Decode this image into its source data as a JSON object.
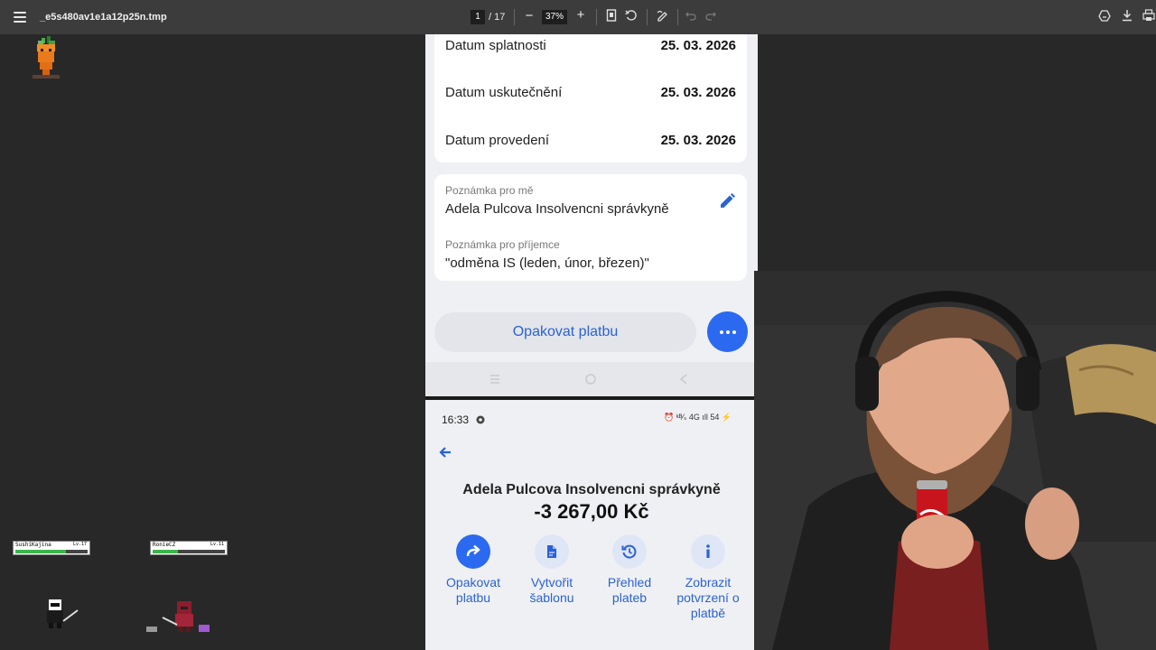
{
  "viewer": {
    "file_name": "_e5s480av1e1a12p25n.tmp",
    "page_current": "1",
    "page_total": "/ 17",
    "zoom": "37%",
    "zoom_out": "−",
    "zoom_in": "+"
  },
  "overlay": {
    "players": [
      {
        "name": "SushiKajina",
        "level": "Lv.17",
        "hp_fraction": 0.7
      },
      {
        "name": "RonieCZ",
        "level": "Lv.11",
        "hp_fraction": 0.35
      }
    ]
  },
  "payment_details": {
    "rows": [
      {
        "label": "Datum splatnosti",
        "value": "25. 03. 2026"
      },
      {
        "label": "Datum uskutečnění",
        "value": "25. 03. 2026"
      },
      {
        "label": "Datum provedení",
        "value": "25. 03. 2026"
      }
    ],
    "note_for_me_label": "Poznámka pro mě",
    "note_for_me": "Adela Pulcova Insolvencni správkyně",
    "note_for_recipient_label": "Poznámka pro příjemce",
    "note_for_recipient": "\"odměna IS (leden, únor, březen)\"",
    "repeat_button": "Opakovat platbu"
  },
  "payment_summary": {
    "status_time": "16:33",
    "status_icons": "⏰ ᵏᴮ⁄ₛ 4G ıll 54 ⚡",
    "recipient": "Adela Pulcova Insolvencni správkyně",
    "amount": "-3 267,00 Kč",
    "actions": [
      {
        "line1": "Opakovat",
        "line2": "platbu",
        "line3": "",
        "icon": "repeat-icon"
      },
      {
        "line1": "Vytvořit",
        "line2": "šablonu",
        "line3": "",
        "icon": "template-icon"
      },
      {
        "line1": "Přehled",
        "line2": "plateb",
        "line3": "",
        "icon": "history-icon"
      },
      {
        "line1": "Zobrazit",
        "line2": "potvrzení o",
        "line3": "platbě",
        "icon": "info-icon"
      }
    ]
  },
  "colors": {
    "accent": "#2b6af0",
    "link": "#2a62d6",
    "toolbar": "#3c3c3c",
    "background": "#282828"
  }
}
